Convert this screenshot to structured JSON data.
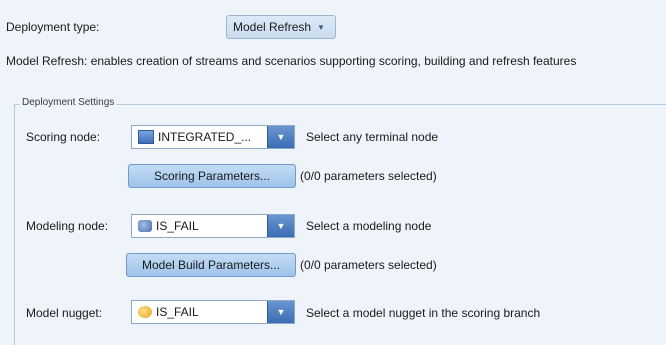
{
  "deployment": {
    "type_label": "Deployment type:",
    "type_value": "Model Refresh",
    "caret": "▼",
    "description": "Model Refresh: enables creation of streams and scenarios supporting scoring, building and refresh features"
  },
  "settings": {
    "legend": "Deployment Settings",
    "scoring": {
      "label": "Scoring node:",
      "value": "INTEGRATED_...",
      "icon": "terminal-node-icon",
      "hint": "Select any terminal node",
      "params_button": "Scoring Parameters...",
      "params_note": "(0/0 parameters selected)"
    },
    "modeling": {
      "label": "Modeling node:",
      "value": "IS_FAIL",
      "icon": "modeling-node-icon",
      "hint": "Select a modeling node",
      "params_button": "Model Build Parameters...",
      "params_note": "(0/0 parameters selected)"
    },
    "nugget": {
      "label": "Model nugget:",
      "value": "IS_FAIL",
      "icon": "model-nugget-icon",
      "hint": "Select a model nugget in the scoring branch"
    }
  },
  "colors": {
    "background": "#eef4fa",
    "accent": "#3c6db3"
  }
}
